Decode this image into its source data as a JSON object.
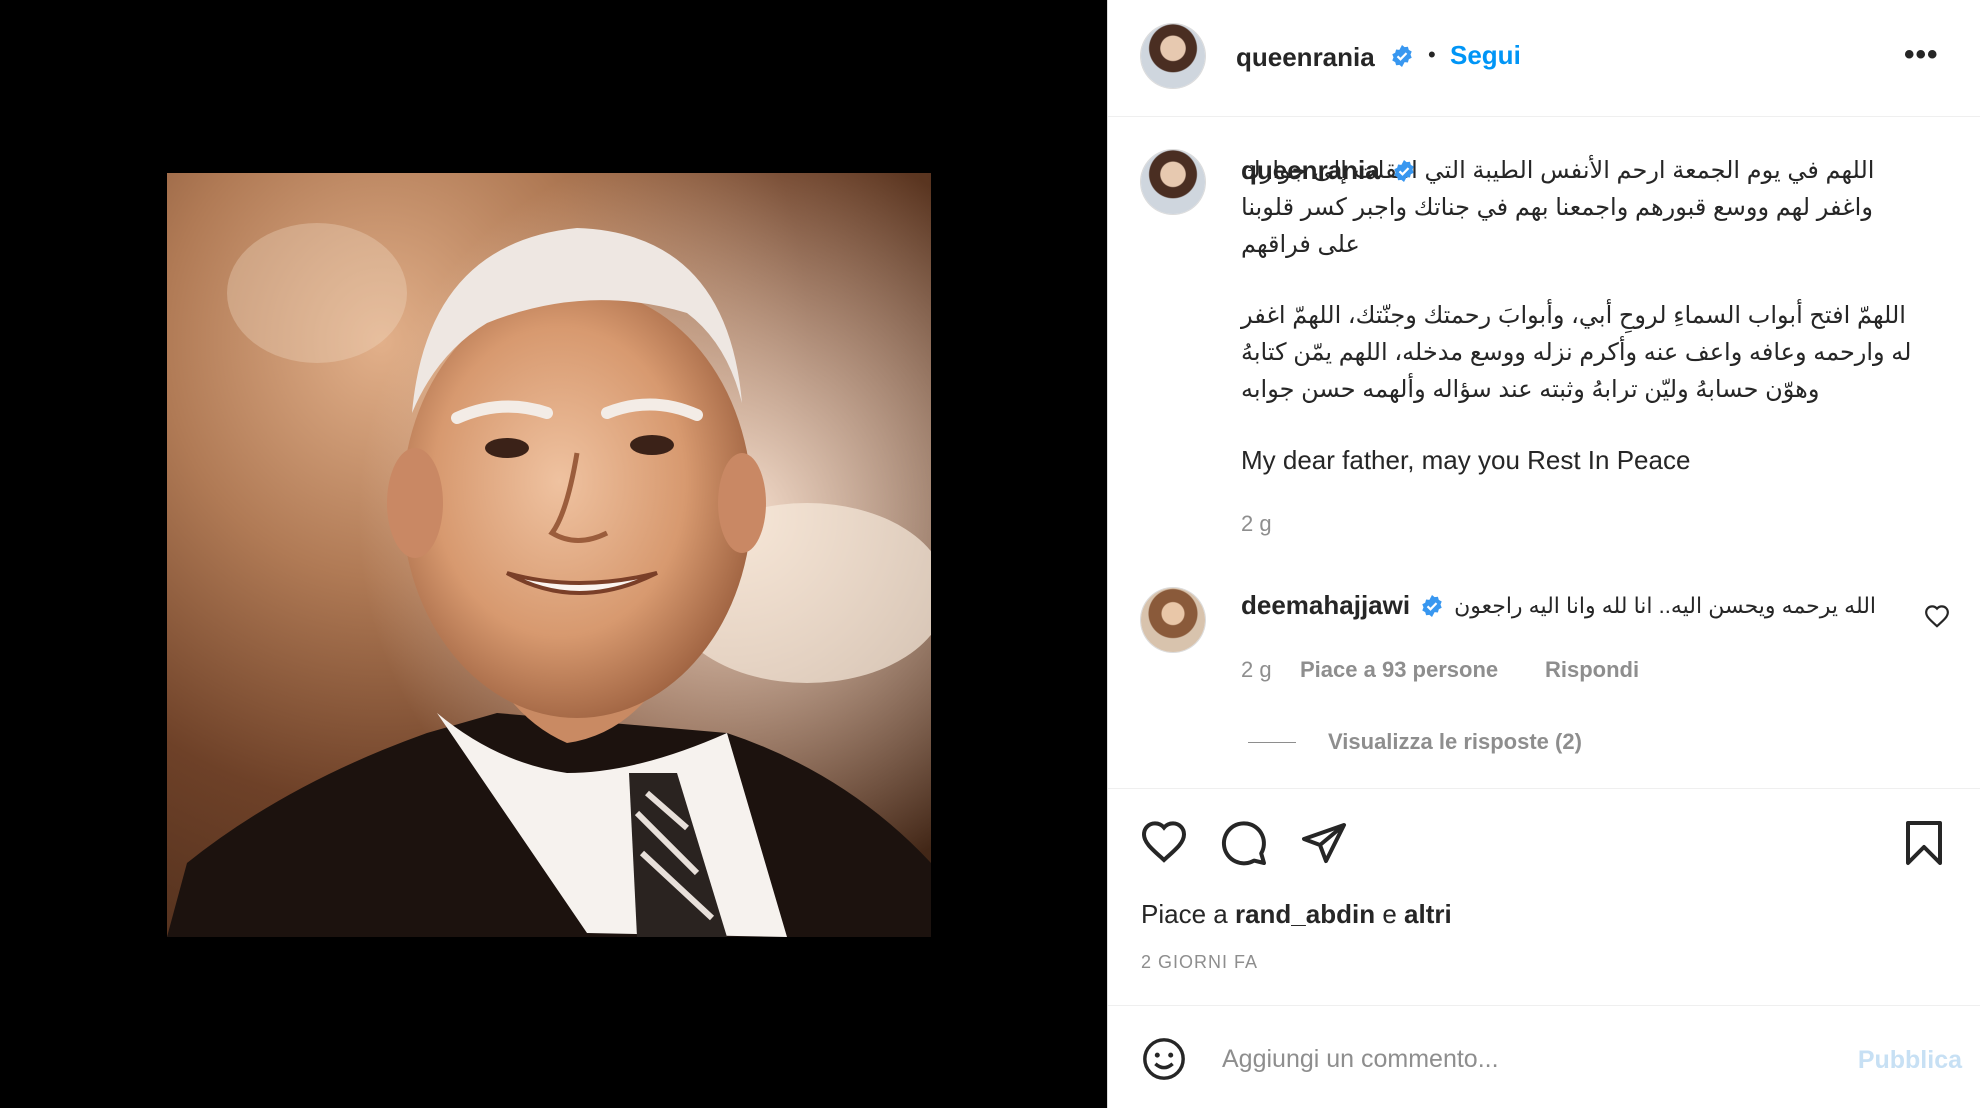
{
  "post": {
    "author": "queenrania",
    "follow_label": "Segui",
    "separator": "•",
    "more_label": "•••"
  },
  "caption": {
    "username": "queenrania",
    "paragraph1": "اللهم في يوم الجمعة ارحم الأنفس الطيبة التي انتقلت إلى جوارك واغفر لهم ووسع قبورهم واجمعنا بهم في جناتك واجبر كسر قلوبنا على فراقهم",
    "paragraph2": "اللهمّ افتح أبواب السماءِ لروحِ أبي، وأبوابَ رحمتك وجنّتك، اللهمّ اغفر له وارحمه وعافه واعف عنه وأكرم نزله ووسع مدخله، اللهم يمّن كتابهُ وهوّن حسابهُ وليّن ترابهُ وثبته عند سؤاله وألهمه حسن جوابه",
    "paragraph3": "My dear father, may you Rest In Peace",
    "time": "2 g"
  },
  "comment": {
    "username": "deemahajjawi",
    "text": "الله يرحمه ويحسن اليه.. انا لله وانا اليه راجعون",
    "time": "2 g",
    "likes": "Piace a 93 persone",
    "reply": "Rispondi",
    "view_replies": "Visualizza le risposte (2)"
  },
  "actions": {
    "likes_prefix": "Piace a",
    "likes_user": "rand_abdin",
    "likes_join": "e",
    "likes_others": "altri",
    "date": "2 GIORNI FA"
  },
  "comment_bar": {
    "placeholder": "Aggiungi un commento...",
    "publish_label": "Pubblica"
  },
  "colors": {
    "accent": "#0095f6",
    "verified": "#3897f0",
    "muted": "#8e8e8e",
    "publish_disabled": "#c7e0f4"
  },
  "icons": [
    "verified-badge-icon",
    "more-icon",
    "heart-icon",
    "comment-icon",
    "share-icon",
    "bookmark-icon",
    "emoji-icon",
    "comment-heart-icon"
  ]
}
